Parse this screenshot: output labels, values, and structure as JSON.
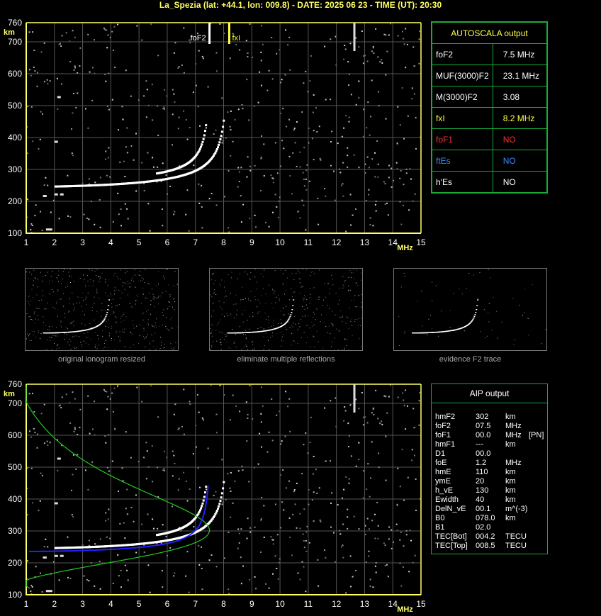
{
  "header": {
    "title": "La_Spezia (lat: +44.1, lon: 009.8) - DATE: 2025 06 23 - TIME (UT): 20:30"
  },
  "ionogram_axes": {
    "y_unit": "km",
    "x_unit": "MHz",
    "y_ticks": [
      "760",
      "700",
      "600",
      "500",
      "400",
      "300",
      "200",
      "100"
    ],
    "x_ticks": [
      "1",
      "2",
      "3",
      "4",
      "5",
      "6",
      "7",
      "8",
      "9",
      "10",
      "11",
      "12",
      "13",
      "14",
      "15"
    ]
  },
  "top_plot": {
    "markers": [
      {
        "label": "foF2",
        "freq": 7.5
      },
      {
        "label": "fxI",
        "freq": 8.2
      }
    ]
  },
  "autoscala": {
    "title": "AUTOSCALA output",
    "rows": [
      {
        "label": "foF2",
        "value": "7.5 MHz",
        "label_color": "#ffffff",
        "value_color": "#ffffff"
      },
      {
        "label": "MUF(3000)F2",
        "value": "23.1 MHz",
        "label_color": "#ffffff",
        "value_color": "#ffffff"
      },
      {
        "label": "M(3000)F2",
        "value": "3.08",
        "label_color": "#ffffff",
        "value_color": "#ffffff"
      },
      {
        "label": "fxI",
        "value": "8.2 MHz",
        "label_color": "#ffff44",
        "value_color": "#ffff44"
      },
      {
        "label": "foF1",
        "value": "NO",
        "label_color": "#ff3030",
        "value_color": "#ff3030"
      },
      {
        "label": "ftEs",
        "value": "NO",
        "label_color": "#3a8cff",
        "value_color": "#3a8cff"
      },
      {
        "label": "h'Es",
        "value": "NO",
        "label_color": "#ffffff",
        "value_color": "#ffffff"
      }
    ]
  },
  "thumbnails": [
    {
      "caption": "original ionogram resized"
    },
    {
      "caption": "eliminate multiple reflections"
    },
    {
      "caption": "evidence F2 trace"
    }
  ],
  "aip": {
    "title": "AIP output",
    "rows": [
      {
        "k": "hmF2",
        "v": "302",
        "u": "km",
        "x": ""
      },
      {
        "k": "foF2",
        "v": "07.5",
        "u": "MHz",
        "x": ""
      },
      {
        "k": "foF1",
        "v": "00.0",
        "u": "MHz",
        "x": "[PN]"
      },
      {
        "k": "hmF1",
        "v": "---",
        "u": "km",
        "x": ""
      },
      {
        "k": "D1",
        "v": "00.0",
        "u": "",
        "x": ""
      },
      {
        "k": "foE",
        "v": "1.2",
        "u": "MHz",
        "x": ""
      },
      {
        "k": "hmE",
        "v": "110",
        "u": "km",
        "x": ""
      },
      {
        "k": "ymE",
        "v": "20",
        "u": "km",
        "x": ""
      },
      {
        "k": "h_vE",
        "v": "130",
        "u": "km",
        "x": ""
      },
      {
        "k": "Ewidth",
        "v": "40",
        "u": "km",
        "x": ""
      },
      {
        "k": "DelN_vE",
        "v": "00.1",
        "u": "m^(-3)",
        "x": ""
      },
      {
        "k": "B0",
        "v": "078.0",
        "u": "km",
        "x": ""
      },
      {
        "k": "B1",
        "v": "02.0",
        "u": "",
        "x": ""
      },
      {
        "k": "TEC[Bot]",
        "v": "004.2",
        "u": "TECU",
        "x": ""
      },
      {
        "k": "TEC[Top]",
        "v": "008.5",
        "u": "TECU",
        "x": ""
      }
    ]
  },
  "colors": {
    "grid": "#555555",
    "axis": "#ffff66",
    "trace": "#ffffff",
    "profile": "#22cc22",
    "aip_trace": "#2222ff",
    "panel_border": "#1aaa3a"
  }
}
